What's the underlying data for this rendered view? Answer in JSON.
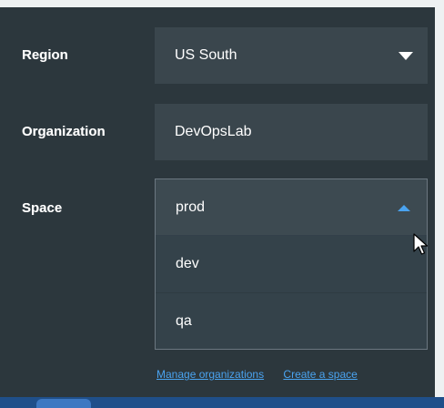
{
  "form": {
    "region": {
      "label": "Region",
      "value": "US South"
    },
    "organization": {
      "label": "Organization",
      "value": "DevOpsLab"
    },
    "space": {
      "label": "Space",
      "value": "prod",
      "options": [
        "dev",
        "qa"
      ]
    }
  },
  "links": {
    "manage_organizations": "Manage organizations",
    "create_space": "Create a space"
  },
  "icons": {
    "region_caret": "chevron-down-icon",
    "space_caret": "chevron-up-icon",
    "cursor": "mouse-pointer-icon"
  },
  "colors": {
    "link": "#4aa3f0",
    "field_bg": "#3a464d",
    "panel_bg": "#2c373d"
  }
}
